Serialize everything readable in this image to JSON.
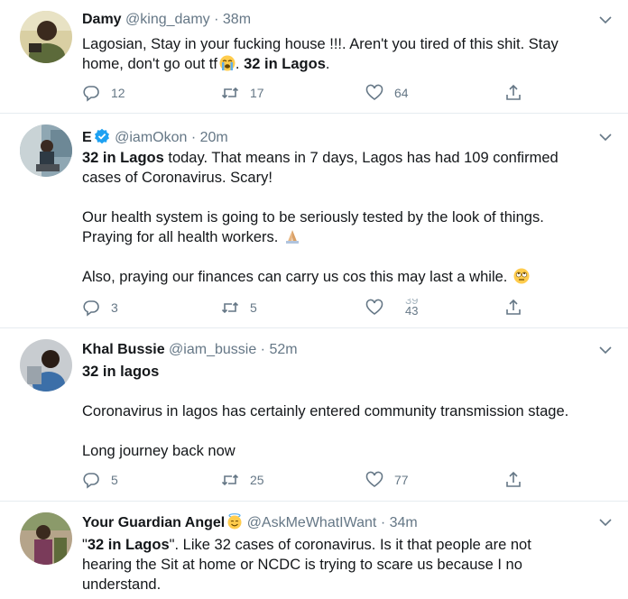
{
  "tweets": [
    {
      "name": "Damy",
      "handle": "@king_damy",
      "dot": "·",
      "time": "38m",
      "text_line1": "Lagosian, Stay in your fucking house !!!. Aren't you tired of this shit. Stay",
      "text_line2_a": "home, don't go out tf",
      "text_line2_bold": "32 in Lagos",
      "text_line2_end": ".",
      "emoji": "loudly-crying-face",
      "replies": "12",
      "retweets": "17",
      "likes": "64"
    },
    {
      "name": "E",
      "handle": "@iamOkon",
      "dot": "·",
      "time": "20m",
      "line1_bold": "32 in Lagos",
      "line1_rest": " today. That means in 7 days, Lagos has had 109 confirmed",
      "line2": "cases of Coronavirus. Scary!",
      "line3": "Our health system is going to be seriously tested by the look of things.",
      "line4": "Praying for all health workers.",
      "line5": "Also, praying our finances can carry us cos this may last a while.",
      "emoji1": "folded-hands",
      "emoji2": "face-with-rolling-eyes",
      "replies": "3",
      "retweets": "5",
      "likes_prev": "39",
      "likes": "43"
    },
    {
      "name": "Khal Bussie",
      "handle": "@iam_bussie",
      "dot": "·",
      "time": "52m",
      "line1_bold": "32 in lagos",
      "line2": "Coronavirus in lagos has certainly entered community transmission stage.",
      "line3": "Long journey back now",
      "replies": "5",
      "retweets": "25",
      "likes": "77"
    },
    {
      "name": "Your Guardian Angel",
      "handle": "@AskMeWhatIWant",
      "dot": "·",
      "time": "34m",
      "emoji": "smiling-face-with-halo",
      "line1_a": "\"",
      "line1_bold": "32 in Lagos",
      "line1_rest": "\". Like 32 cases of coronavirus. Is it that people are not",
      "line2": "hearing the Sit at home or NCDC is trying to scare us because I no",
      "line3": "understand."
    }
  ],
  "colors": {
    "text": "#14171a",
    "muted": "#657786",
    "verified": "#1da1f2",
    "divider": "#e6ecf0"
  }
}
